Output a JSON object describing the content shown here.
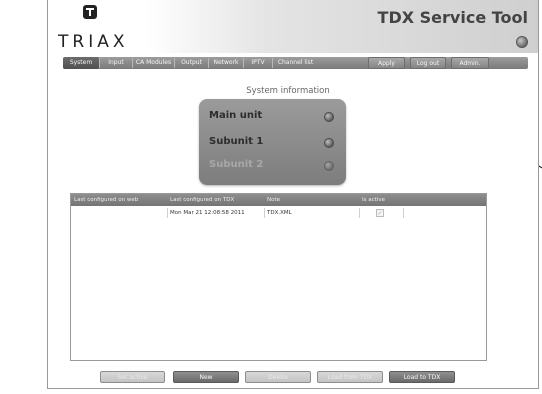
{
  "header": {
    "brand": "TRIAX",
    "app_title": "TDX Service Tool"
  },
  "nav": {
    "tabs": [
      {
        "label": "System",
        "active": true
      },
      {
        "label": "Input"
      },
      {
        "label": "CA Modules"
      },
      {
        "label": "Output"
      },
      {
        "label": "Network"
      },
      {
        "label": "IPTV"
      },
      {
        "label": "Channel list"
      }
    ],
    "actions": {
      "apply": "Apply",
      "logout": "Log out",
      "admin": "Admin."
    }
  },
  "system_info": {
    "title": "System information",
    "units": [
      {
        "label": "Main unit"
      },
      {
        "label": "Subunit 1"
      },
      {
        "label": "Subunit 2"
      }
    ]
  },
  "config_table": {
    "headers": [
      "Last configured on web",
      "Last configured on TDX",
      "Note",
      "Is active"
    ],
    "rows": [
      {
        "web": "",
        "tdx": "Mon Mar 21 12:08:58 2011",
        "note": "TDX.XML",
        "active_mark": "✓"
      }
    ]
  },
  "bottom_buttons": {
    "set_active": "Set active",
    "new": "New",
    "delete": "Delete",
    "load_from_tdx": "Load from TDX",
    "load_to_tdx": "Load to TDX"
  }
}
